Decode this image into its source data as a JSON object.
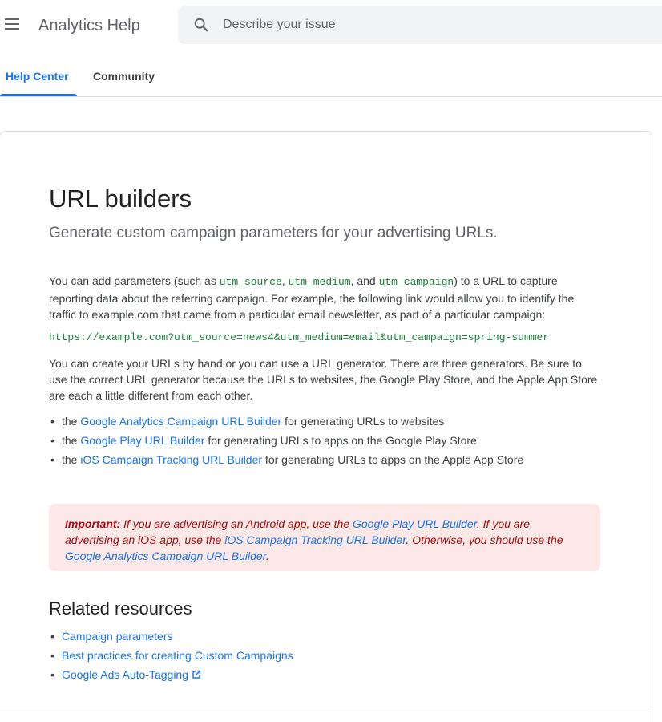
{
  "header": {
    "menu_icon": "hamburger-menu-icon",
    "app_title": "Analytics Help",
    "search": {
      "placeholder": "Describe your issue",
      "value": "",
      "icon": "search-icon"
    }
  },
  "tabs": [
    {
      "label": "Help Center",
      "active": true
    },
    {
      "label": "Community",
      "active": false
    }
  ],
  "article": {
    "title": "URL builders",
    "subtitle": "Generate custom campaign parameters for your advertising URLs.",
    "p1": {
      "t1": "You can add parameters (such as ",
      "c1": "utm_source",
      "t2": ", ",
      "c2": "utm_medium",
      "t3": ", and ",
      "c3": "utm_campaign",
      "t4": ") to a URL to capture reporting data about the referring campaign. For example, the following link would allow you to identify the traffic to example.com that came from a particular email newsletter, as part of a particular campaign:"
    },
    "example_url": "https://example.com?utm_source=news4&utm_medium=email&utm_campaign=spring-summer",
    "p2": "You can create your URLs by hand or you can use a URL generator. There are three generators. Be sure to use the correct URL generator because the URLs to websites, the Google Play Store, and the Apple App Store are each a little different from each other.",
    "generators": [
      {
        "prefix": "the ",
        "link": "Google Analytics Campaign URL Builder",
        "suffix": " for generating URLs to websites"
      },
      {
        "prefix": "the ",
        "link": "Google Play URL Builder",
        "suffix": " for generating URLs to apps on the Google Play Store"
      },
      {
        "prefix": "the ",
        "link": "iOS Campaign Tracking URL Builder",
        "suffix": " for generating URLs to apps on the Apple App Store"
      }
    ],
    "notice": {
      "label": "Important:",
      "t1": " If you are advertising an Android app, use the ",
      "l1": "Google Play URL Builder",
      "t2": ". If you are advertising an iOS app, use the ",
      "l2": "iOS Campaign Tracking URL Builder",
      "t3": ". Otherwise, you should use the ",
      "l3": "Google Analytics Campaign URL Builder",
      "t4": "."
    },
    "related": {
      "title": "Related resources",
      "items": [
        {
          "label": "Campaign parameters",
          "external": false
        },
        {
          "label": "Best practices for creating Custom Campaigns",
          "external": false
        },
        {
          "label": "Google Ads Auto-Tagging",
          "external": true,
          "icon": "external-link-icon"
        }
      ]
    }
  },
  "colors": {
    "accent": "#1a73e8",
    "notice_bg": "#fce8e6",
    "notice_text": "#a50e0e",
    "code": "#188038"
  }
}
